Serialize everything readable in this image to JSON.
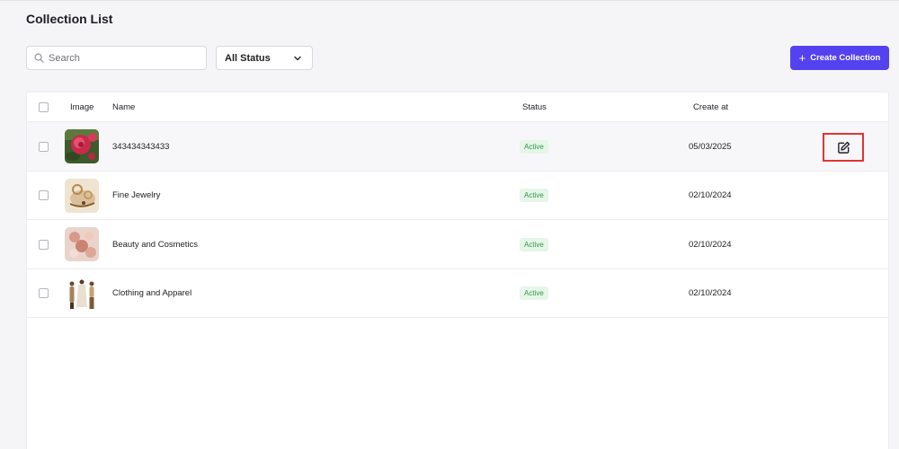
{
  "page": {
    "title": "Collection List"
  },
  "toolbar": {
    "search_placeholder": "Search",
    "status_filter": "All Status",
    "create_label": "Create Collection"
  },
  "table": {
    "columns": {
      "image": "Image",
      "name": "Name",
      "status": "Status",
      "created": "Create at"
    },
    "rows": [
      {
        "name": "343434343433",
        "status": "Active",
        "created": "05/03/2025",
        "thumb": "rose-photo"
      },
      {
        "name": "Fine Jewelry",
        "status": "Active",
        "created": "02/10/2024",
        "thumb": "jewelry-photo"
      },
      {
        "name": "Beauty and Cosmetics",
        "status": "Active",
        "created": "02/10/2024",
        "thumb": "cosmetics-photo"
      },
      {
        "name": "Clothing and Apparel",
        "status": "Active",
        "created": "02/10/2024",
        "thumb": "apparel-photo"
      }
    ]
  },
  "colors": {
    "accent": "#5442f0",
    "active_badge_bg": "#e6f6e9",
    "active_badge_text": "#2e9a47",
    "highlight_border": "#e23434"
  },
  "icons": {
    "search": "search-icon",
    "dropdown": "chevron-down-icon",
    "create": "plus-icon",
    "edit": "edit-icon"
  }
}
